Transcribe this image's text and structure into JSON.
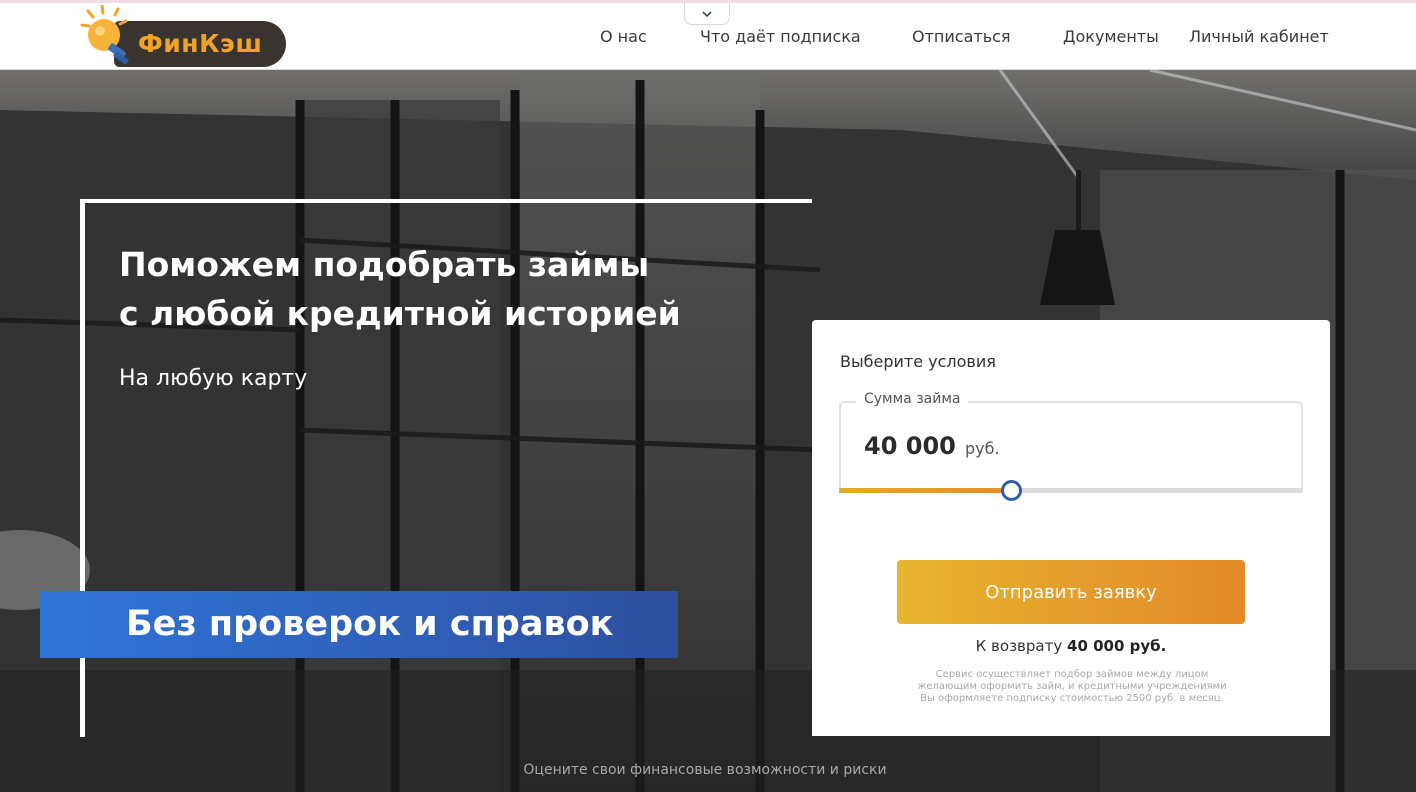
{
  "header": {
    "logo_text": "ФинКэш",
    "nav": [
      {
        "label": "О нас"
      },
      {
        "label": "Что даёт подписка"
      },
      {
        "label": "Отписаться"
      },
      {
        "label": "Документы"
      },
      {
        "label": "Личный кабинет"
      }
    ]
  },
  "hero": {
    "title_line1": "Поможем подобрать займы",
    "title_line2": "с любой кредитной историей",
    "subtitle": "На любую карту",
    "banner": "Без проверок и справок",
    "footer_note": "Оцените свои финансовые возможности и риски"
  },
  "form": {
    "title": "Выберите условия",
    "amount_label": "Сумма займа",
    "amount_value": "40 000",
    "amount_unit": "руб.",
    "slider_fraction": 0.37,
    "submit_label": "Отправить заявку",
    "return_prefix": "К возврату",
    "return_amount": "40 000 руб.",
    "disclaimer_line1": "Сервис осуществляет подбор займов между лицом",
    "disclaimer_line2": "желающим оформить займ, и кредитными учреждениями",
    "disclaimer_line3": "Вы оформляете подписку стоимостью 2500 руб. в месяц."
  },
  "colors": {
    "accent_orange": "#e6a92a",
    "banner_blue": "#2f74d7",
    "slider_thumb": "#2f5ea8",
    "logo_dark": "#3a3430"
  },
  "icons": {
    "logo": "lightbulb-icon",
    "collapse": "chevron-down-icon"
  }
}
